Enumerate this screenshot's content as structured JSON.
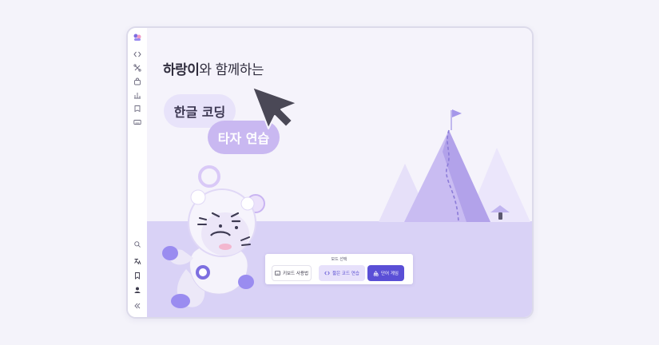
{
  "colors": {
    "accent": "#5a4fd6",
    "accent_light": "#e7e1fb",
    "floor": "#d9d2f6",
    "pill_light": "#e8e3fa",
    "pill_purple": "#c9b8f1",
    "mountain": "#b7a7ec"
  },
  "sidebar": {
    "top_icons": [
      "logo-icon",
      "code-icon",
      "puzzle-icon",
      "bag-icon",
      "chart-icon",
      "book-icon",
      "keyboard-icon"
    ],
    "bottom_icons": [
      "search-icon",
      "translate-icon",
      "bookmark-icon",
      "user-icon",
      "collapse-icon"
    ]
  },
  "hero": {
    "heading_bold": "하랑이",
    "heading_rest": "와 함께하는",
    "pill_primary": "한글 코딩",
    "pill_secondary": "타자 연습"
  },
  "mode_panel": {
    "title": "모드 선택",
    "buttons": [
      {
        "label": "키보드 사용법",
        "icon": "keyboard-icon"
      },
      {
        "label": "짧은 코드 연습",
        "icon": "code-icon"
      },
      {
        "label": "단어 게임",
        "icon": "shapes-icon"
      }
    ]
  }
}
